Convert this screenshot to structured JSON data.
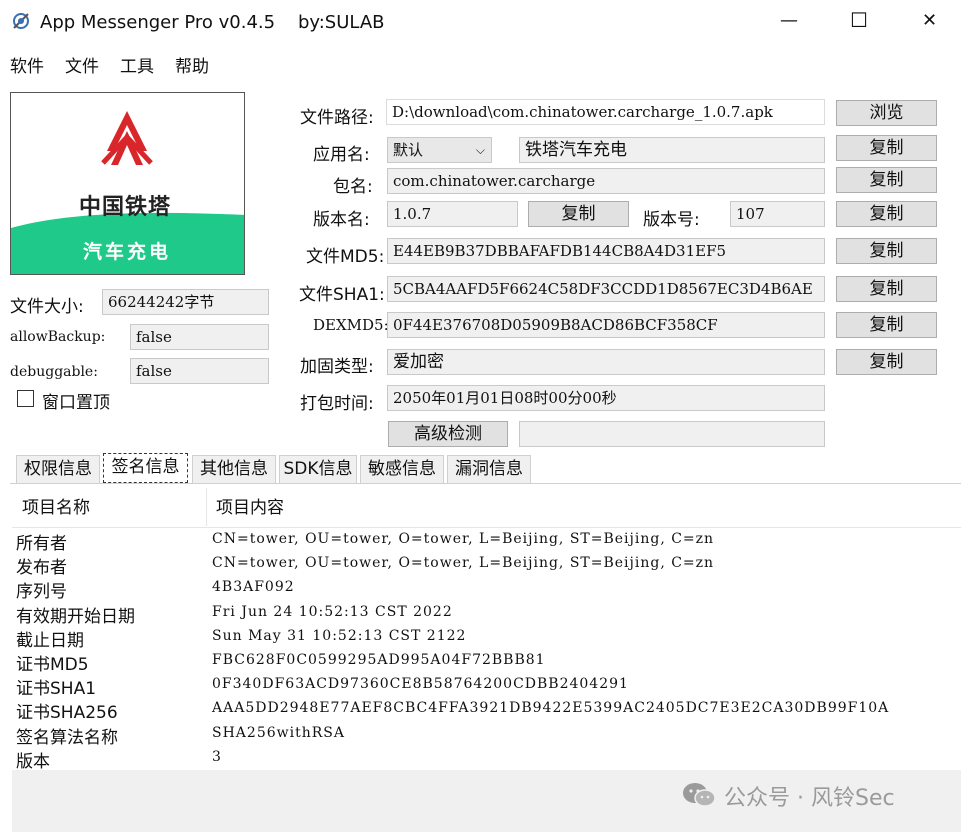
{
  "window": {
    "title": "App Messenger Pro v0.4.5    by:SULAB",
    "minimize": "—",
    "maximize": "☐",
    "close": "✕"
  },
  "menu": [
    "软件",
    "文件",
    "工具",
    "帮助"
  ],
  "logo": {
    "brand_text": "中国铁塔",
    "sub_text": "汽车充电",
    "colors": {
      "red": "#d9262a",
      "green": "#1fc98a",
      "dark": "#222222"
    }
  },
  "left_info": {
    "file_size_label": "文件大小:",
    "file_size_value": "66244242字节",
    "allow_backup_label": "allowBackup:",
    "allow_backup_value": "false",
    "debuggable_label": "debuggable:",
    "debuggable_value": "false",
    "window_top_label": "窗口置顶"
  },
  "form": {
    "file_path_label": "文件路径:",
    "file_path_value": "D:\\download\\com.chinatower.carcharge_1.0.7.apk",
    "browse": "浏览",
    "app_name_label": "应用名:",
    "app_name_select": "默认",
    "app_name_value": "铁塔汽车充电",
    "copy": "复制",
    "package_label": "包名:",
    "package_value": "com.chinatower.carcharge",
    "version_name_label": "版本名:",
    "version_name_value": "1.0.7",
    "version_code_label": "版本号:",
    "version_code_value": "107",
    "md5_label": "文件MD5:",
    "md5_value": "E44EB9B37DBBAFAFDB144CB8A4D31EF5",
    "sha1_label": "文件SHA1:",
    "sha1_value": "5CBA4AAFD5F6624C58DF3CCDD1D8567EC3D4B6AE",
    "dexmd5_label": "DEXMD5:",
    "dexmd5_value": "0F44E376708D05909B8ACD86BCF358CF",
    "packer_label": "加固类型:",
    "packer_value": "爱加密",
    "pack_time_label": "打包时间:",
    "pack_time_value": "2050年01月01日08时00分00秒",
    "advanced_check": "高级检测"
  },
  "tabs": [
    "权限信息",
    "签名信息",
    "其他信息",
    "SDK信息",
    "敏感信息",
    "漏洞信息"
  ],
  "active_tab": "签名信息",
  "table": {
    "headers": [
      "项目名称",
      "项目内容"
    ],
    "rows": [
      {
        "name": "所有者",
        "value": "CN=tower, OU=tower, O=tower, L=Beijing, ST=Beijing, C=zn"
      },
      {
        "name": "发布者",
        "value": "CN=tower, OU=tower, O=tower, L=Beijing, ST=Beijing, C=zn"
      },
      {
        "name": "序列号",
        "value": "4B3AF092"
      },
      {
        "name": "有效期开始日期",
        "value": "Fri Jun 24 10:52:13 CST 2022"
      },
      {
        "name": "截止日期",
        "value": "Sun May 31 10:52:13 CST 2122"
      },
      {
        "name": "证书MD5",
        "value": "FBC628F0C0599295AD995A04F72BBB81"
      },
      {
        "name": "证书SHA1",
        "value": "0F340DF63ACD97360CE8B58764200CDBB2404291"
      },
      {
        "name": "证书SHA256",
        "value": "AAA5DD2948E77AEF8CBC4FFA3921DB9422E5399AC2405DC7E3E2CA30DB99F10A"
      },
      {
        "name": "签名算法名称",
        "value": "SHA256withRSA"
      },
      {
        "name": "版本",
        "value": "3"
      }
    ]
  },
  "watermark": "公众号 · 风铃Sec"
}
